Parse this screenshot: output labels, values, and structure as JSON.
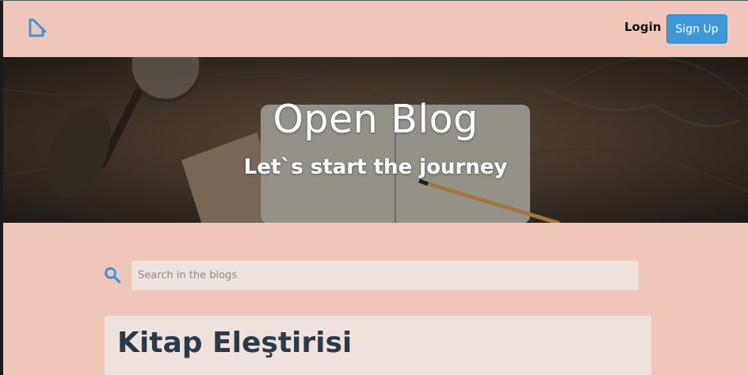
{
  "navbar": {
    "logo_icon": "pencil-square-icon",
    "login_label": "Login",
    "signup_label": "Sign Up",
    "accent_color": "#3d97d8"
  },
  "hero": {
    "title": "Open Blog",
    "subtitle": "Let`s start the journey"
  },
  "search": {
    "icon": "search-icon",
    "placeholder": "Search in the blogs",
    "value": ""
  },
  "posts": [
    {
      "title": "Kitap Eleştirisi"
    }
  ],
  "colors": {
    "page_background": "#f0c6b8",
    "card_background": "#efe1dc",
    "title_text": "#2a3a4a"
  }
}
